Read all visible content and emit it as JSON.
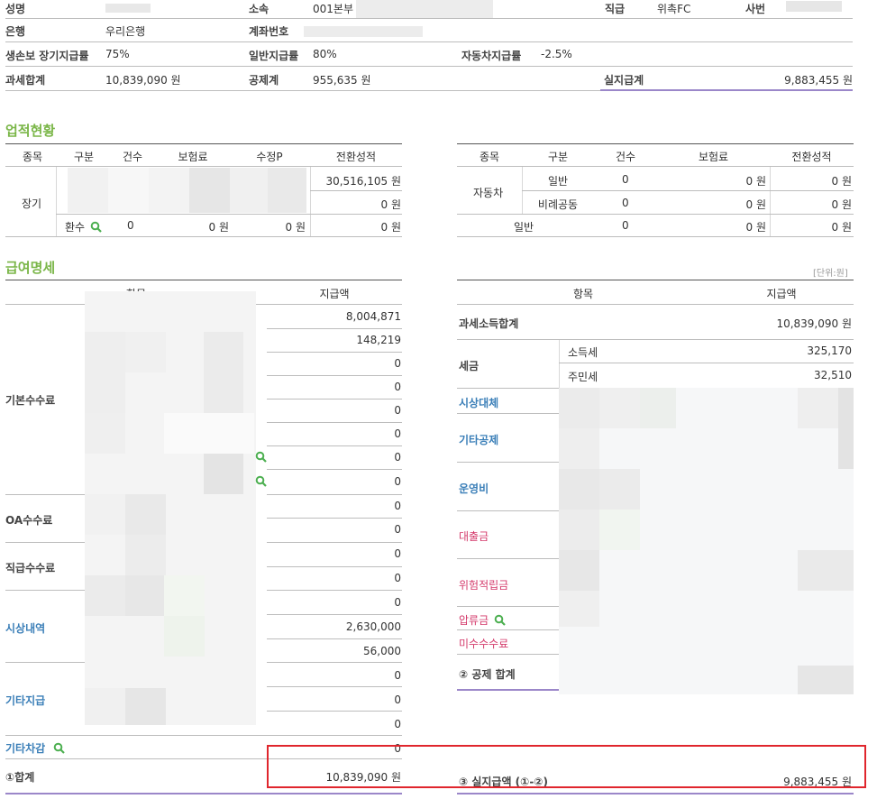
{
  "info": {
    "name_label": "성명",
    "dept_label": "소속",
    "dept_value": "001본부",
    "rank_label": "직급",
    "rank_value": "위촉FC",
    "empno_label": "사번",
    "bank_label": "은행",
    "bank_value": "우리은행",
    "account_label": "계좌번호",
    "life_rate_label": "생손보 장기지급률",
    "life_rate_value": "75%",
    "general_rate_label": "일반지급률",
    "general_rate_value": "80%",
    "auto_rate_label": "자동차지급률",
    "auto_rate_value": "-2.5%",
    "taxable_label": "과세합계",
    "taxable_value": "10,839,090 원",
    "deduct_label": "공제계",
    "deduct_value": "955,635 원",
    "net_label": "실지급계",
    "net_value": "9,883,455 원"
  },
  "performance": {
    "title": "업적현황",
    "left_headers": [
      "종목",
      "구분",
      "건수",
      "보험료",
      "수정P",
      "전환성적"
    ],
    "left_category": "장기",
    "left_amounts": [
      "30,516,105 원",
      "0 원"
    ],
    "refund_row": {
      "label": "환수",
      "count": "0",
      "premium": "0 원",
      "modified": "0 원",
      "score": "0 원"
    },
    "right_headers": [
      "종목",
      "구분",
      "건수",
      "보험료",
      "전환성적"
    ],
    "right_category": "자동차",
    "right_rows": [
      {
        "type": "일반",
        "count": "0",
        "premium": "0 원",
        "score": "0 원"
      },
      {
        "type": "비례공동",
        "count": "0",
        "premium": "0 원",
        "score": "0 원"
      },
      {
        "type": "일반",
        "count": "0",
        "premium": "0 원",
        "score": "0 원"
      }
    ]
  },
  "salary": {
    "title": "급여명세",
    "unit": "[단위:원]",
    "left_headers": [
      "항목",
      "지급액"
    ],
    "left_amounts": [
      "8,004,871",
      "148,219",
      "0",
      "0",
      "0",
      "0",
      "0",
      "0",
      "0",
      "0",
      "0",
      "0",
      "0",
      "2,630,000",
      "56,000",
      "0",
      "0",
      "0",
      "0"
    ],
    "left_groups": {
      "basic": "기본수수료",
      "oa": "OA수수료",
      "rank": "직급수수료",
      "award": "시상내역",
      "other_pay": "기타지급",
      "other_deduct": "기타차감"
    },
    "total_label": "①합계",
    "total_value": "10,839,090 원",
    "right_headers": [
      "항목",
      "지급액"
    ],
    "taxable_total_label": "과세소득합계",
    "taxable_total_value": "10,839,090 원",
    "tax_label": "세금",
    "income_tax_label": "소득세",
    "income_tax_value": "325,170",
    "resident_tax_label": "주민세",
    "resident_tax_value": "32,510",
    "right_groups": {
      "award_sub": "시상대체",
      "other_deduct": "기타공제",
      "operating": "운영비",
      "loan": "대출금",
      "risk": "위험적립금",
      "seizure": "압류금",
      "unpaid": "미수수수료"
    },
    "deduct_total_label": "② 공제 합계",
    "net_label": "③ 실지급액 (①-②)",
    "net_value": "9,883,455 원"
  },
  "colors": {
    "green": "#7ab648",
    "blue": "#3b7fb8",
    "pink": "#d43a6b",
    "purple": "#9b87c9",
    "red": "#e0262d"
  },
  "icons": {
    "search": "magnifier-icon"
  }
}
